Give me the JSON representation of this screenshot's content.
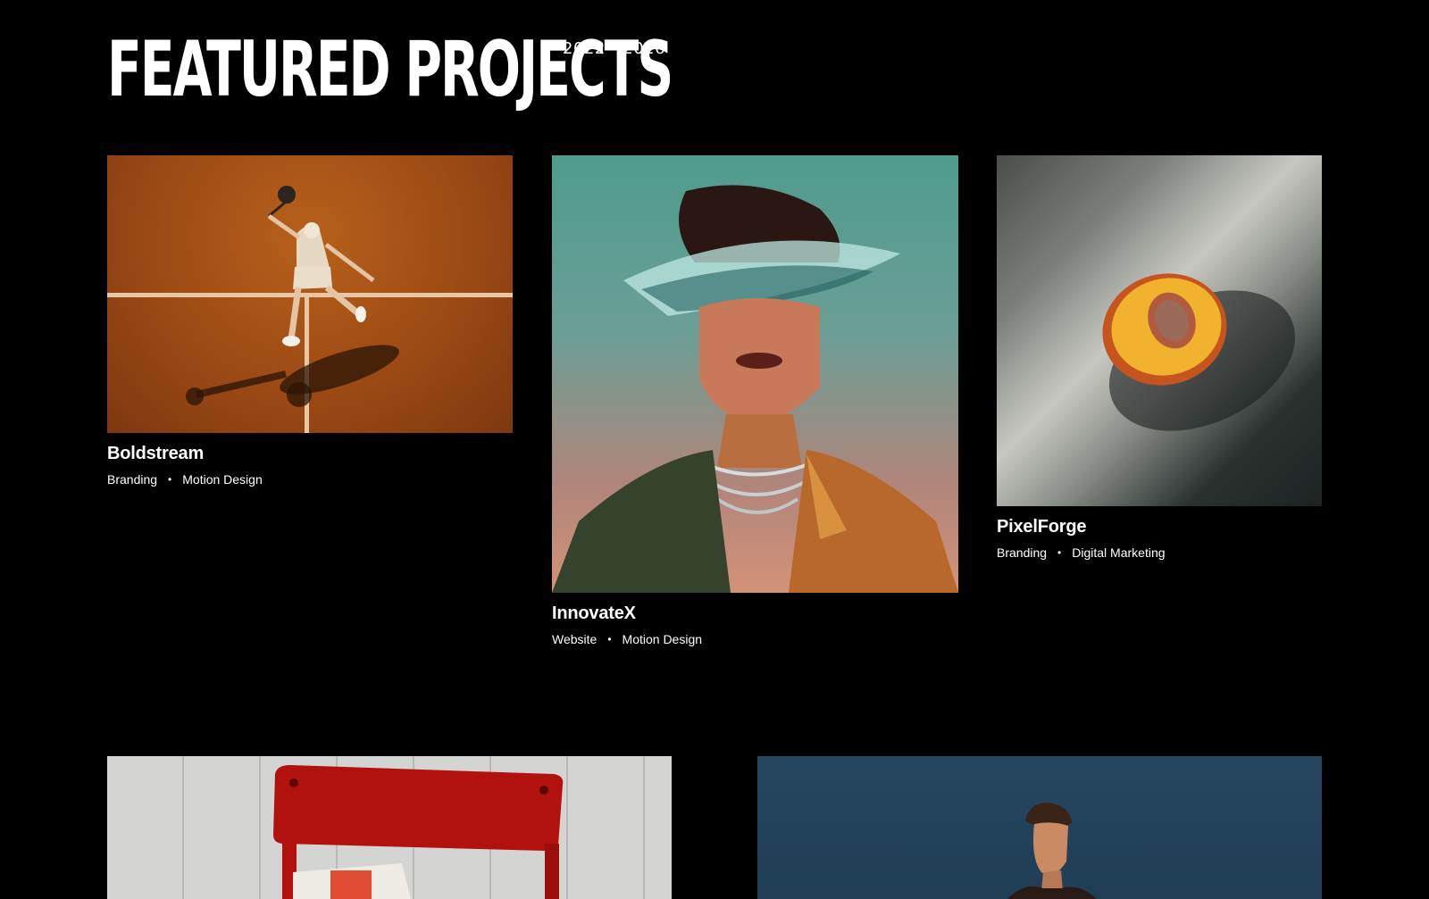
{
  "header": {
    "title": "FEATURED PROJECTS",
    "years": "2022 - 2026"
  },
  "projects": [
    {
      "name": "Boldstream",
      "tags": [
        "Branding",
        "Motion Design"
      ]
    },
    {
      "name": "InnovateX",
      "tags": [
        "Website",
        "Motion Design"
      ]
    },
    {
      "name": "PixelForge",
      "tags": [
        "Branding",
        "Digital Marketing"
      ]
    }
  ],
  "separator": "•",
  "colors": {
    "background": "#000000",
    "text": "#ffffff"
  }
}
